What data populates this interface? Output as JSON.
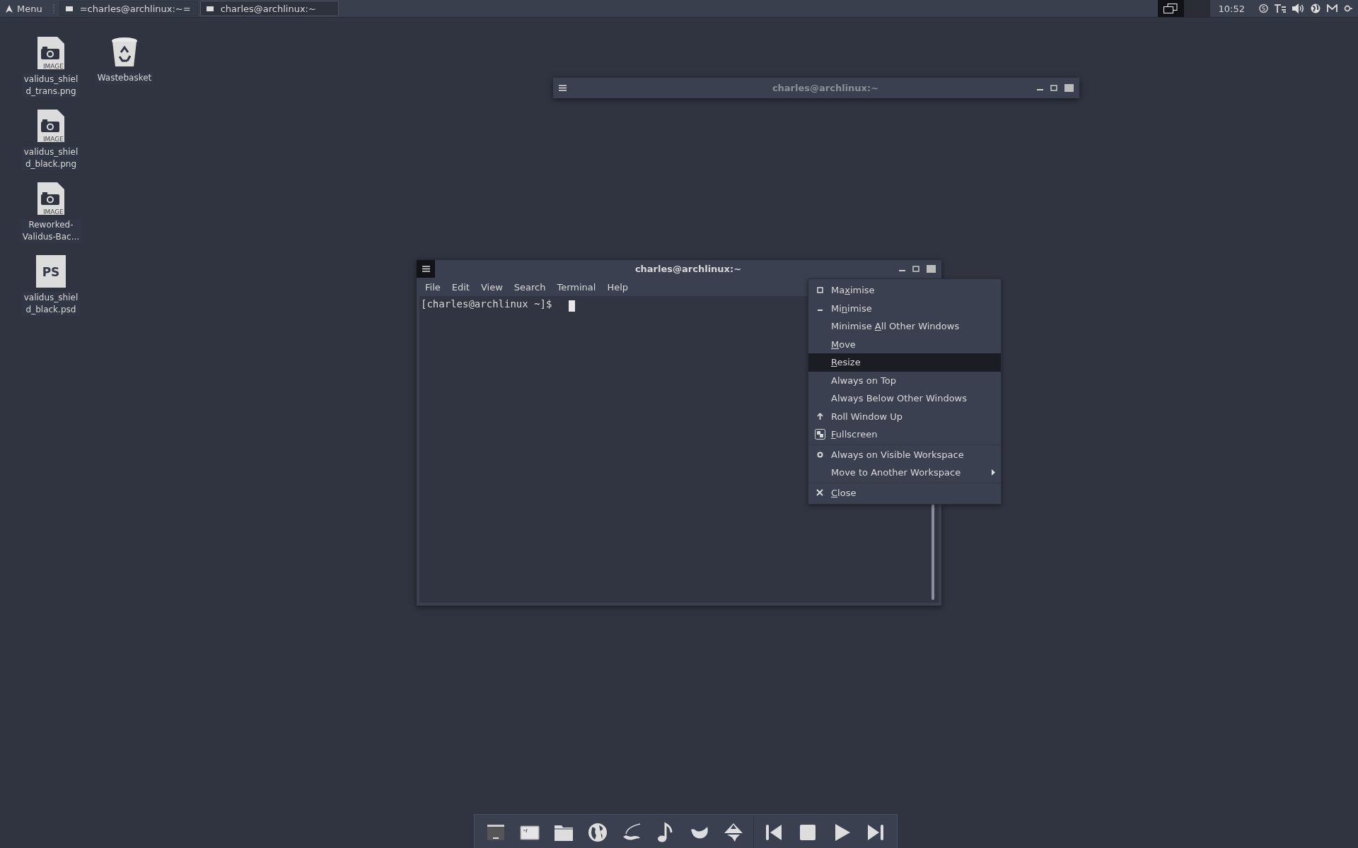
{
  "top_panel": {
    "menu_button": "Menu",
    "tasks": [
      {
        "title": "=charles@archlinux:~=",
        "selected": false
      },
      {
        "title": "charles@archlinux:~",
        "selected": true
      }
    ],
    "workspaces": [
      {
        "selected": true
      },
      {
        "selected": false
      }
    ],
    "clock": "10:52"
  },
  "desktop_icons": [
    {
      "kind": "image",
      "icon_text": "IMAGE",
      "label_lines": [
        "validus_shiel",
        "d_trans.png"
      ]
    },
    {
      "kind": "image",
      "icon_text": "IMAGE",
      "label_lines": [
        "validus_shiel",
        "d_black.png"
      ]
    },
    {
      "kind": "image",
      "icon_text": "IMAGE",
      "label_lines": [
        "Reworked-",
        "Validus-Bac..."
      ]
    },
    {
      "kind": "psd",
      "icon_text": "PS",
      "label_lines": [
        "validus_shiel",
        "d_black.psd"
      ]
    },
    {
      "kind": "trash",
      "label_lines": [
        "Wastebasket"
      ]
    }
  ],
  "background_window": {
    "title": "charles@archlinux:~",
    "focused": false
  },
  "terminal_window": {
    "title": "charles@archlinux:~",
    "focused": true,
    "menu": [
      "File",
      "Edit",
      "View",
      "Search",
      "Terminal",
      "Help"
    ],
    "prompt": "[charles@archlinux ~]$"
  },
  "context_menu": [
    {
      "kind": "maximise",
      "before": "Ma",
      "mnemonic": "x",
      "after": "imise",
      "selected": false
    },
    {
      "kind": "minimise",
      "before": "Mi",
      "mnemonic": "n",
      "after": "imise",
      "selected": false
    },
    {
      "kind": "plain",
      "before": "Minimise ",
      "mnemonic": "A",
      "after": "ll Other Windows",
      "selected": false
    },
    {
      "kind": "plain",
      "mnemonic": "M",
      "after": "ove",
      "selected": false
    },
    {
      "kind": "plain",
      "mnemonic": "R",
      "after": "esize",
      "selected": true
    },
    {
      "kind": "plain",
      "label": "Always on Top",
      "selected": false
    },
    {
      "kind": "plain",
      "label": "Always Below Other Windows",
      "selected": false
    },
    {
      "kind": "rollup",
      "label": "Roll Window Up",
      "selected": false
    },
    {
      "kind": "fullscreen",
      "mnemonic": "F",
      "after": "ullscreen",
      "selected": false
    },
    {
      "kind": "sticky",
      "label": "Always on Visible Workspace",
      "selected": false,
      "separator_before": true
    },
    {
      "kind": "plain",
      "label": "Move to Another Workspace",
      "selected": false,
      "submenu": true
    },
    {
      "kind": "close",
      "mnemonic": "C",
      "after": "lose",
      "selected": false,
      "separator_before": true
    }
  ]
}
